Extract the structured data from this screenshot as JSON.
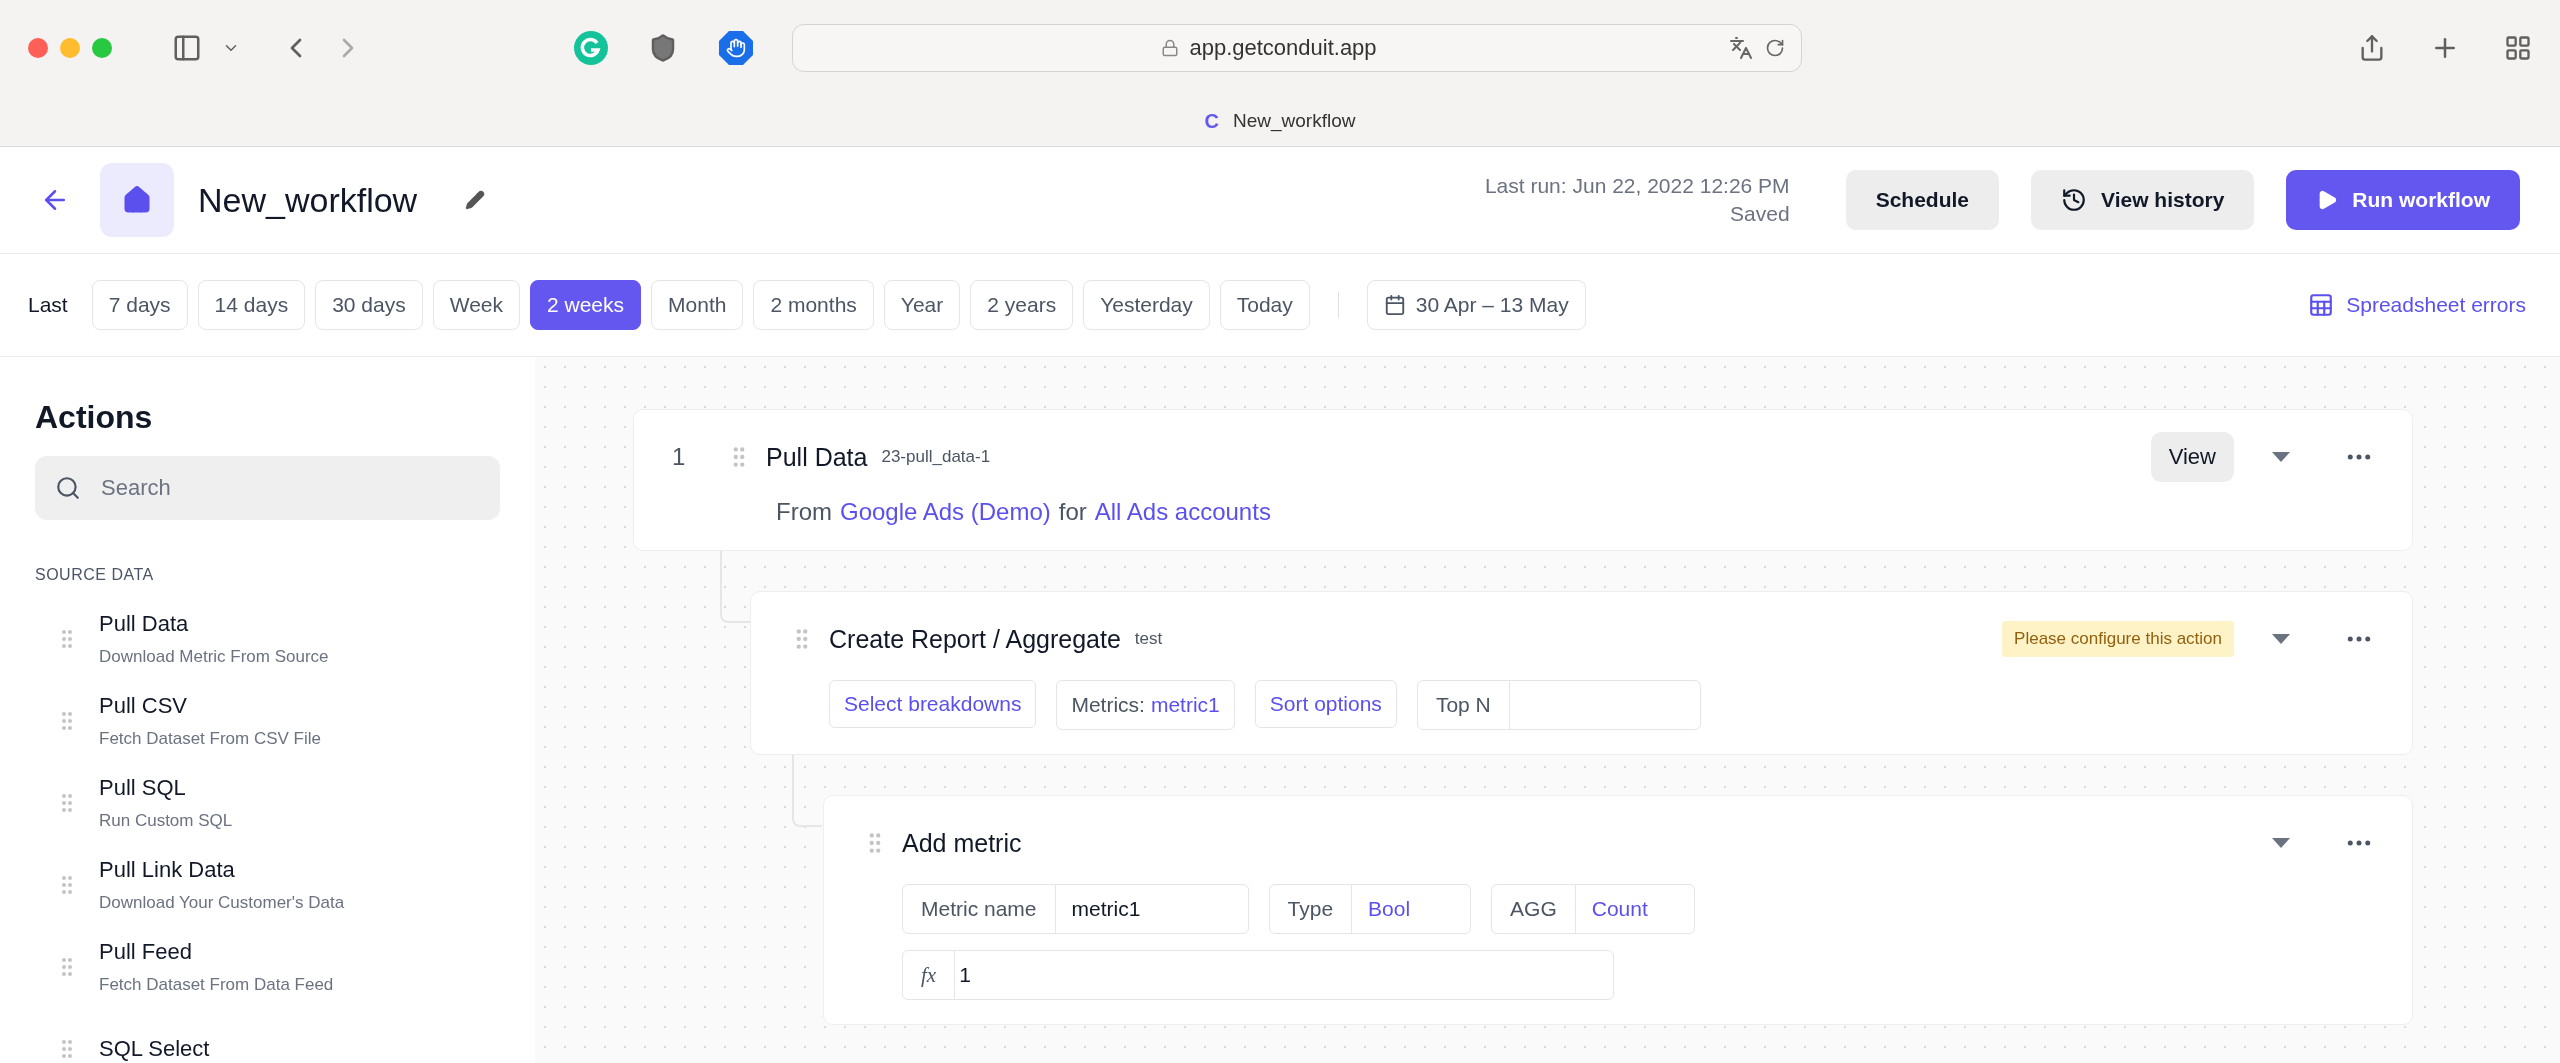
{
  "browser": {
    "url": "app.getconduit.app",
    "tab_logo": "C",
    "tab_title": "New_workflow"
  },
  "header": {
    "title": "New_workflow",
    "last_run": "Last run: Jun 22, 2022 12:26 PM",
    "status": "Saved",
    "buttons": [
      {
        "label": "Schedule",
        "kind": "plain"
      },
      {
        "label": "View history",
        "kind": "history"
      },
      {
        "label": "Run workflow",
        "kind": "primary"
      }
    ]
  },
  "filters": {
    "label": "Last",
    "ranges": [
      {
        "label": "7 days",
        "selected": false
      },
      {
        "label": "14 days",
        "selected": false
      },
      {
        "label": "30 days",
        "selected": false
      },
      {
        "label": "Week",
        "selected": false
      },
      {
        "label": "2 weeks",
        "selected": true
      },
      {
        "label": "Month",
        "selected": false
      },
      {
        "label": "2 months",
        "selected": false
      },
      {
        "label": "Year",
        "selected": false
      },
      {
        "label": "2 years",
        "selected": false
      },
      {
        "label": "Yesterday",
        "selected": false
      },
      {
        "label": "Today",
        "selected": false
      }
    ],
    "date_range": "30 Apr – 13 May",
    "spreadsheet_errors": "Spreadsheet errors"
  },
  "sidebar": {
    "title": "Actions",
    "search_placeholder": "Search",
    "sections": [
      {
        "title": "SOURCE DATA",
        "items": [
          {
            "title": "Pull Data",
            "subtitle": "Download Metric From Source"
          },
          {
            "title": "Pull CSV",
            "subtitle": "Fetch Dataset From CSV File"
          },
          {
            "title": "Pull SQL",
            "subtitle": "Run Custom SQL"
          },
          {
            "title": "Pull Link Data",
            "subtitle": "Download Your Customer's Data"
          },
          {
            "title": "Pull Feed",
            "subtitle": "Fetch Dataset From Data Feed"
          },
          {
            "title": "SQL Select"
          }
        ]
      }
    ]
  },
  "steps": [
    {
      "kind": "pull",
      "number": "1",
      "title": "Pull Data",
      "tag": "23-pull_data-1",
      "button": "View",
      "source": {
        "prefix": "From",
        "link": "Google Ads (Demo)",
        "joiner": "for",
        "account": "All Ads accounts"
      },
      "children": [
        {
          "kind": "aggregate",
          "title": "Create Report / Aggregate",
          "tag": "test",
          "warning": "Please configure this action",
          "options": [
            {
              "kind": "link",
              "label": "Select breakdowns"
            },
            {
              "kind": "labeled",
              "label": "Metrics:",
              "value": "metric1"
            },
            {
              "kind": "link",
              "label": "Sort options"
            },
            {
              "kind": "input",
              "label": "Top N"
            }
          ],
          "children": [
            {
              "kind": "metric",
              "title": "Add metric",
              "fields": [
                {
                  "kind": "text",
                  "label": "Metric name",
                  "value": "metric1"
                },
                {
                  "kind": "select",
                  "label": "Type",
                  "value": "Bool"
                },
                {
                  "kind": "select",
                  "label": "AGG",
                  "value": "Count"
                }
              ],
              "formula": {
                "label": "fx",
                "value": "1"
              }
            }
          ]
        }
      ]
    }
  ]
}
